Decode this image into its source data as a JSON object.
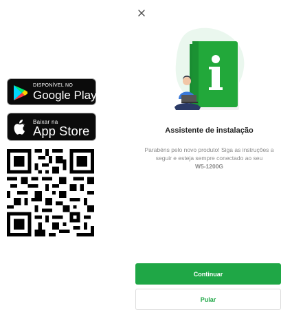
{
  "store_badges": {
    "google": {
      "small": "DISPONÍVEL NO",
      "big": "Google Play",
      "icon": "google-play-icon"
    },
    "apple": {
      "small": "Baixar na",
      "big": "App Store",
      "icon": "apple-icon"
    }
  },
  "qr": {
    "icon": "qr-code"
  },
  "wizard": {
    "close_icon": "close-icon",
    "title": "Assistente de instalação",
    "description": "Parabéns pelo novo produto! Siga as instruções a seguir e esteja sempre conectado ao seu",
    "model": "W5-1200G",
    "continue_label": "Continuar",
    "skip_label": "Pular"
  },
  "colors": {
    "accent": "#1fa746",
    "book": "#22a83a",
    "dark": "#0b0b0b"
  }
}
